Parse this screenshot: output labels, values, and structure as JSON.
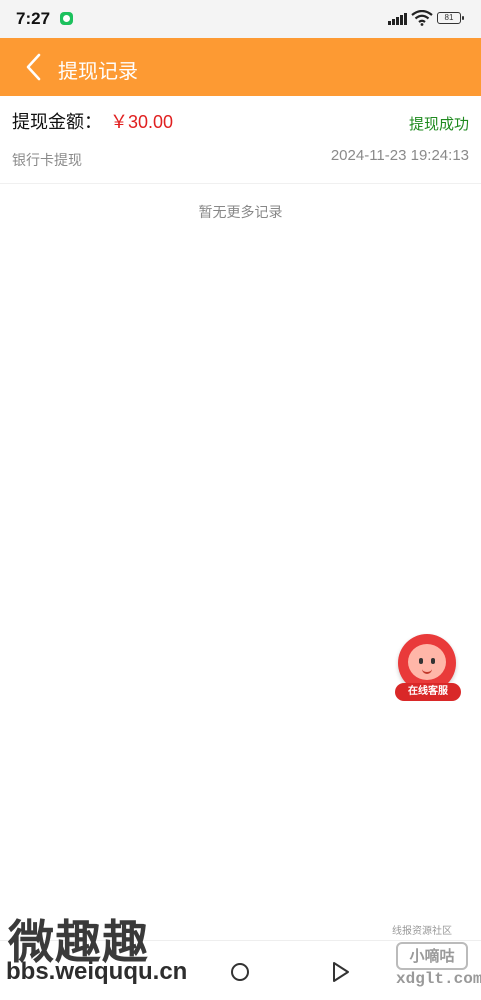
{
  "status_bar": {
    "time": "7:27",
    "battery": "81"
  },
  "header": {
    "title": "提现记录"
  },
  "records": [
    {
      "amount_label": "提现金额：",
      "amount": "￥30.00",
      "status": "提现成功",
      "method": "银行卡提现",
      "time": "2024-11-23 19:24:13"
    }
  ],
  "list_footer": "暂无更多记录",
  "customer_service": {
    "label": "在线客服"
  },
  "watermarks": {
    "left_title": "微趣趣",
    "left_url": "bbs.weiququ.cn",
    "right_top": "线报资源社区",
    "right_logo": "小嘀咕",
    "right_url": "xdglt.com"
  },
  "colors": {
    "header_bg": "#fd9a33",
    "amount": "#e02020",
    "success": "#1f8a1f",
    "muted": "#8a8a8a",
    "cs_red": "#e93a3a"
  },
  "icons": {
    "back": "chevron-left-icon",
    "home": "circle-home-icon",
    "nav_back": "triangle-back-icon",
    "signal": "signal-icon",
    "wifi": "wifi-icon",
    "call": "call-icon",
    "battery": "battery-icon"
  }
}
